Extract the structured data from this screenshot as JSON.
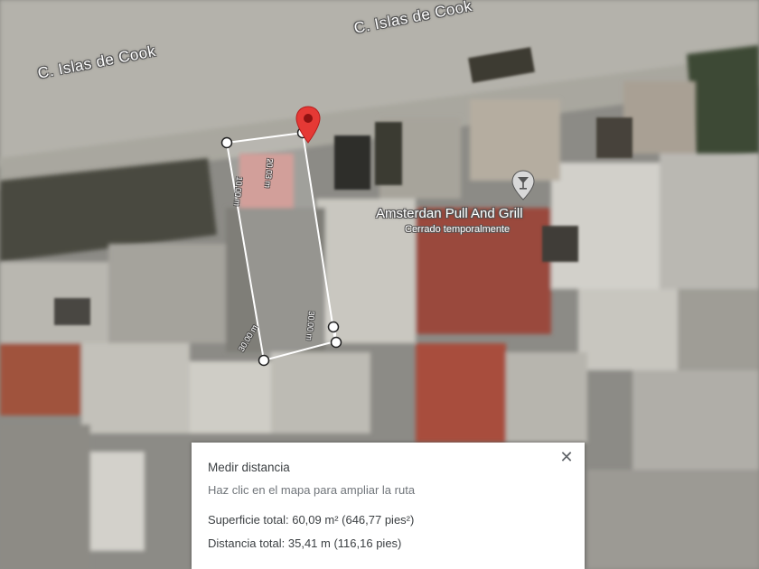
{
  "map": {
    "streets": [
      "C. Islas de Cook",
      "C. Islas de Cook"
    ],
    "poi": {
      "name": "Amsterdan Pull And Grill",
      "status": "Cerrado temporalmente",
      "icon": "glass-icon"
    },
    "measure_labels": [
      "20.03 m",
      "10.00 m",
      "30.00 m",
      "30.00 m"
    ],
    "pin_icon": "map-pin-icon",
    "colors": {
      "pin": "#e53935",
      "polygon_fill": "rgba(255,255,255,0.18)",
      "polygon_stroke": "#ffffff"
    }
  },
  "panel": {
    "title": "Medir distancia",
    "hint": "Haz clic en el mapa para ampliar la ruta",
    "area": "Superficie total: 60,09 m² (646,77 pies²)",
    "distance": "Distancia total: 35,41 m (116,16 pies)",
    "close_icon": "close-icon"
  }
}
